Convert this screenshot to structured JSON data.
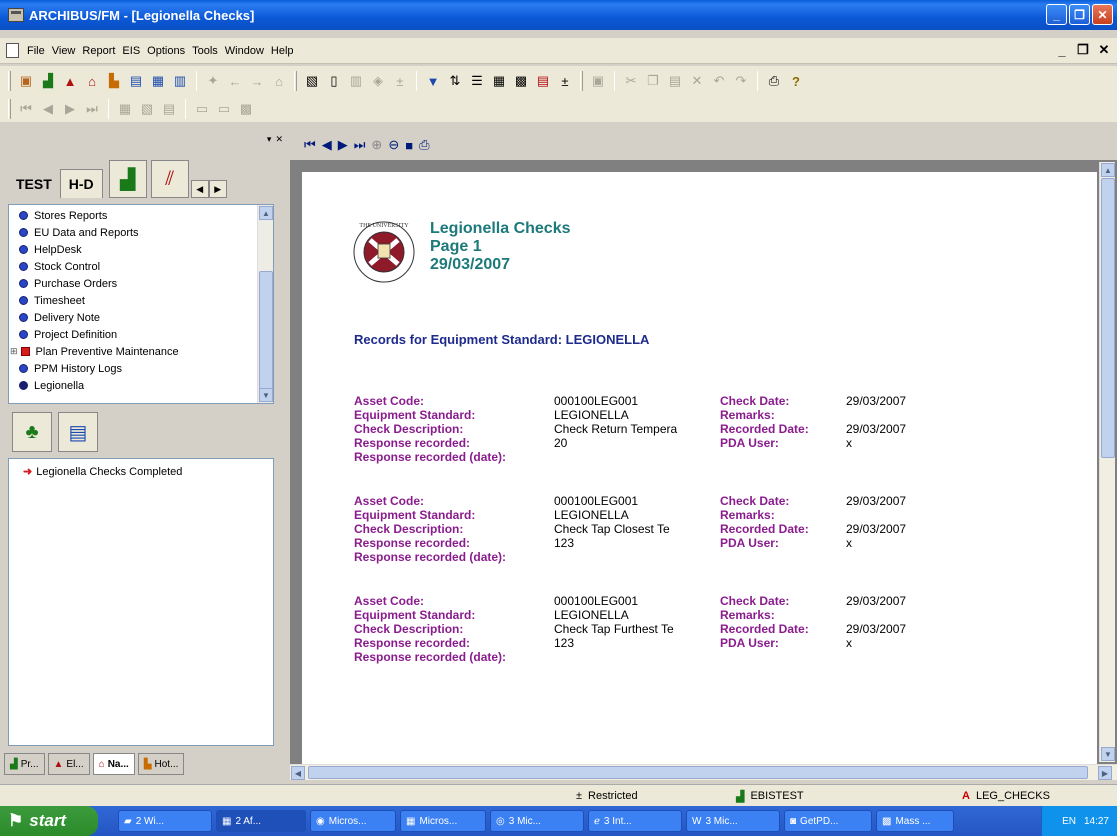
{
  "window": {
    "title": "ARCHIBUS/FM - [Legionella Checks]"
  },
  "menu": [
    "File",
    "View",
    "Report",
    "EIS",
    "Options",
    "Tools",
    "Window",
    "Help"
  ],
  "navigator": {
    "tabs": [
      "TEST",
      "H-D"
    ],
    "items": [
      {
        "label": "Stores Reports",
        "type": "dot"
      },
      {
        "label": "EU Data and Reports",
        "type": "dot"
      },
      {
        "label": "HelpDesk",
        "type": "dot"
      },
      {
        "label": "Stock Control",
        "type": "dot"
      },
      {
        "label": "Purchase Orders",
        "type": "dot"
      },
      {
        "label": "Timesheet",
        "type": "dot"
      },
      {
        "label": "Delivery Note",
        "type": "dot"
      },
      {
        "label": "Project Definition",
        "type": "dot"
      },
      {
        "label": "Plan Preventive Maintenance",
        "type": "red"
      },
      {
        "label": "PPM History Logs",
        "type": "dot"
      },
      {
        "label": "Legionella",
        "type": "dark"
      }
    ],
    "tasks": [
      "Legionella Checks Completed"
    ],
    "bottom_tabs": [
      "Pr...",
      "El...",
      "Na...",
      "Hot..."
    ]
  },
  "report": {
    "title": "Legionella Checks",
    "page": "Page 1",
    "date": "29/03/2007",
    "section_title": "Records for Equipment Standard: LEGIONELLA",
    "labels": {
      "asset_code": "Asset Code:",
      "equipment_standard": "Equipment Standard:",
      "check_description": "Check Description:",
      "response_recorded": "Response recorded:",
      "response_recorded_date": "Response recorded (date):",
      "check_date": "Check Date:",
      "remarks": "Remarks:",
      "recorded_date": "Recorded Date:",
      "pda_user": "PDA User:"
    },
    "records": [
      {
        "asset_code": "000100LEG001",
        "equipment_standard": "LEGIONELLA",
        "check_description": "Check Return Tempera",
        "response_recorded": "20",
        "check_date": "29/03/2007",
        "remarks": "",
        "recorded_date": "29/03/2007",
        "pda_user": "x"
      },
      {
        "asset_code": "000100LEG001",
        "equipment_standard": "LEGIONELLA",
        "check_description": "Check Tap Closest Te",
        "response_recorded": "123",
        "check_date": "29/03/2007",
        "remarks": "",
        "recorded_date": "29/03/2007",
        "pda_user": "x"
      },
      {
        "asset_code": "000100LEG001",
        "equipment_standard": "LEGIONELLA",
        "check_description": "Check Tap Furthest Te",
        "response_recorded": "123",
        "check_date": "29/03/2007",
        "remarks": "",
        "recorded_date": "29/03/2007",
        "pda_user": "x"
      }
    ]
  },
  "status": {
    "restricted": "Restricted",
    "project": "EBISTEST",
    "view": "LEG_CHECKS"
  },
  "taskbar": {
    "start": "start",
    "buttons": [
      "2 Wi...",
      "2 Af...",
      "Micros...",
      "Micros...",
      "3 Mic...",
      "3 Int...",
      "3 Mic...",
      "GetPD...",
      "Mass ..."
    ],
    "lang": "EN",
    "clock": "14:27"
  }
}
